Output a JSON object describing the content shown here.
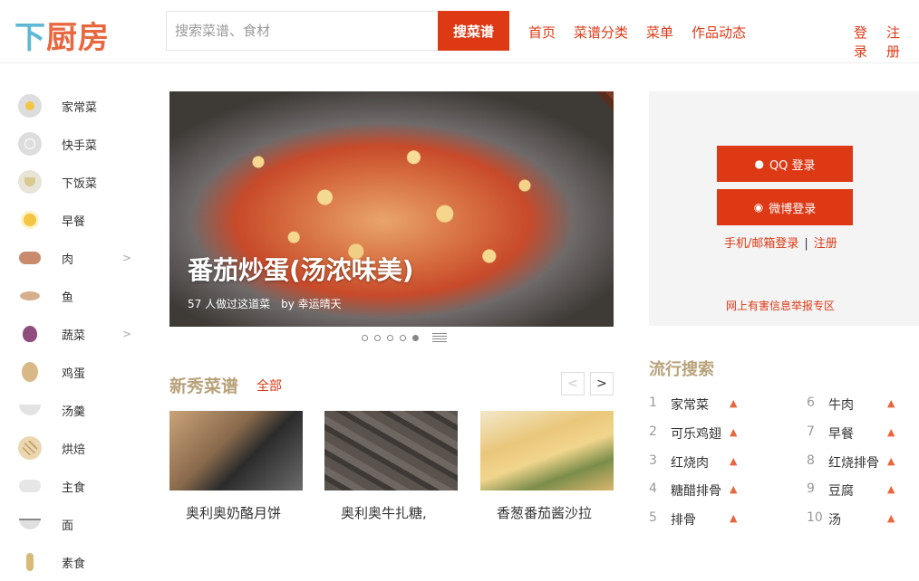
{
  "header": {
    "logo_part1": "下",
    "logo_part2": "厨房",
    "search_placeholder": "搜索菜谱、食材",
    "search_button": "搜菜谱",
    "nav": [
      "首页",
      "菜谱分类",
      "菜单",
      "作品动态"
    ],
    "login": "登录",
    "register": "注册"
  },
  "sidebar": {
    "items": [
      {
        "label": "家常菜",
        "icon": "fried-egg-icon",
        "has_chevron": false
      },
      {
        "label": "快手菜",
        "icon": "clock-icon",
        "has_chevron": false
      },
      {
        "label": "下饭菜",
        "icon": "rice-bowl-icon",
        "has_chevron": false
      },
      {
        "label": "早餐",
        "icon": "sun-icon",
        "has_chevron": false
      },
      {
        "label": "肉",
        "icon": "pig-icon",
        "has_chevron": true
      },
      {
        "label": "鱼",
        "icon": "fish-icon",
        "has_chevron": false
      },
      {
        "label": "蔬菜",
        "icon": "onion-icon",
        "has_chevron": true
      },
      {
        "label": "鸡蛋",
        "icon": "egg-icon",
        "has_chevron": false
      },
      {
        "label": "汤羹",
        "icon": "soup-bowl-icon",
        "has_chevron": false
      },
      {
        "label": "烘焙",
        "icon": "waffle-icon",
        "has_chevron": false
      },
      {
        "label": "主食",
        "icon": "rice-icon",
        "has_chevron": false
      },
      {
        "label": "面",
        "icon": "noodles-icon",
        "has_chevron": false
      },
      {
        "label": "素食",
        "icon": "wheat-icon",
        "has_chevron": false
      }
    ]
  },
  "hero": {
    "title": "番茄炒蛋(汤浓味美)",
    "cooked_count": "57 人做过这道菜",
    "author": "by 幸运晴天"
  },
  "carousel": {
    "total_slides": 5,
    "active_index": 4
  },
  "new_recipes": {
    "title": "新秀菜谱",
    "all_link": "全部",
    "cards": [
      {
        "caption": "奥利奥奶酪月饼"
      },
      {
        "caption": "奥利奥牛扎糖,"
      },
      {
        "caption": "香葱番茄酱沙拉"
      }
    ]
  },
  "login_panel": {
    "qq_login": "QQ 登录",
    "weibo_login": "微博登录",
    "phone_login": "手机/邮箱登录",
    "register": "注册",
    "report": "网上有害信息举报专区"
  },
  "trending": {
    "title": "流行搜索",
    "left": [
      {
        "num": "1",
        "keyword": "家常菜"
      },
      {
        "num": "2",
        "keyword": "可乐鸡翅"
      },
      {
        "num": "3",
        "keyword": "红烧肉"
      },
      {
        "num": "4",
        "keyword": "糖醋排骨"
      },
      {
        "num": "5",
        "keyword": "排骨"
      }
    ],
    "right": [
      {
        "num": "6",
        "keyword": "牛肉"
      },
      {
        "num": "7",
        "keyword": "早餐"
      },
      {
        "num": "8",
        "keyword": "红烧排骨"
      },
      {
        "num": "9",
        "keyword": "豆腐"
      },
      {
        "num": "10",
        "keyword": "汤"
      }
    ]
  },
  "colors": {
    "accent": "#dd3915",
    "title_gold": "#b8a27a",
    "logo_blue": "#5fb8d3",
    "logo_orange": "#e8673f"
  }
}
